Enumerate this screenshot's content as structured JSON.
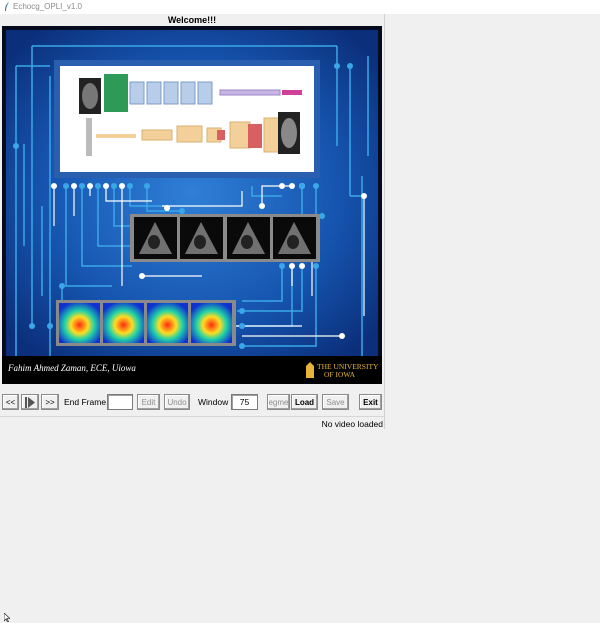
{
  "window": {
    "title": "Echocg_OPLI_v1.0"
  },
  "header": {
    "welcome": "Welcome!!!"
  },
  "banner": {
    "credit": "Fahim Ahmed Zaman, ECE, Uiowa",
    "logo_line1": "THE UNIVERSITY",
    "logo_line2": "OF IOWA",
    "colors": {
      "background": "#0d3d8e",
      "circuit": "#3aa8e8",
      "panel": "#ffffff"
    }
  },
  "toolbar": {
    "rewind_label": "<<",
    "play_icon": "play-icon",
    "forward_label": ">>",
    "end_frame_label": "End Frame",
    "end_frame_value": "",
    "edit_label": "Edit",
    "undo_label": "Undo",
    "window_label": "Window",
    "window_value": "75",
    "segment_label": "egme",
    "load_label": "Load",
    "save_label": "Save",
    "exit_label": "Exit"
  },
  "status": {
    "text": "No video loaded"
  }
}
